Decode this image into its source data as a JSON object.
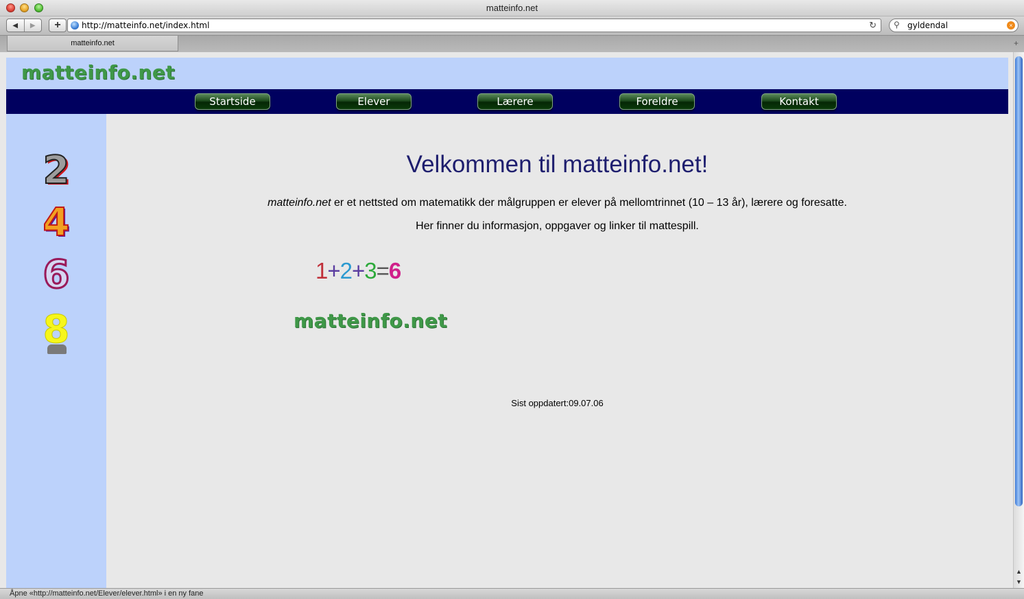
{
  "window": {
    "title": "matteinfo.net"
  },
  "toolbar": {
    "back_icon": "◀",
    "forward_icon": "▶",
    "add_icon": "+",
    "url": "http://matteinfo.net/index.html",
    "reload_icon": "↻",
    "search_icon": "⚲",
    "search_value": "gyldendal",
    "search_clear_icon": "×"
  },
  "tabs": [
    {
      "label": "matteinfo.net"
    }
  ],
  "tabbar": {
    "new_tab_icon": "+"
  },
  "page": {
    "logo": "matteinfo.net",
    "nav": [
      "Startside",
      "Elever",
      "Lærere",
      "Foreldre",
      "Kontakt"
    ],
    "sidebar_numbers": [
      "2",
      "4",
      "6",
      "8"
    ],
    "welcome": "Velkommen til matteinfo.net!",
    "intro_site": "matteinfo.net",
    "intro_rest": " er et nettsted om matematikk der målgruppen er elever på mellomtrinnet (10 – 13 år), lærere og foresatte.",
    "intro2": "Her finner du informasjon, oppgaver og linker til mattespill.",
    "equation": {
      "n1": "1",
      "plus1": "+",
      "n2": "2",
      "plus2": "+",
      "n3": "3",
      "eq": "=",
      "result": "6"
    },
    "logo_bottom": "matteinfo.net",
    "updated": "Sist oppdatert:09.07.06"
  },
  "status": {
    "text": "Åpne «http://matteinfo.net/Elever/elever.html» i en ny fane"
  },
  "colors": {
    "header_bg": "#bcd2fb",
    "nav_bg": "#00005f",
    "logo_green": "#3f9848",
    "page_bg": "#e8e8e8"
  }
}
